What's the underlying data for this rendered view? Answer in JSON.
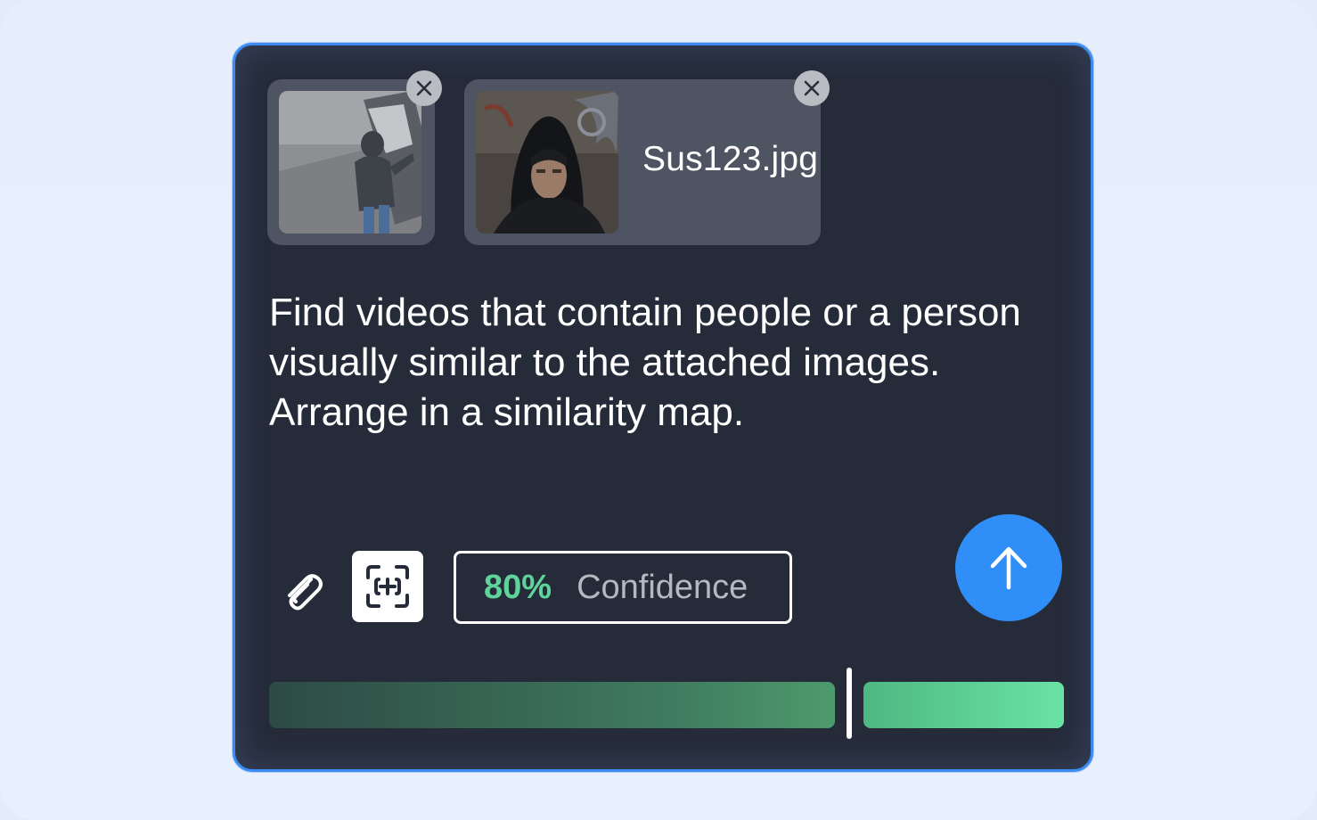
{
  "attachments": [
    {
      "icon": "cctv-person-thumbnail",
      "filename": "",
      "remove_icon": "close-icon"
    },
    {
      "icon": "hooded-person-thumbnail",
      "filename": "Sus123.jpg",
      "remove_icon": "close-icon"
    }
  ],
  "prompt": {
    "text": "Find videos that contain people or a person visually similar to the attached images. Arrange in a similarity map."
  },
  "toolbar": {
    "attach_icon": "paperclip-icon",
    "scan_icon": "scan-add-icon",
    "confidence": {
      "value": "80%",
      "label": "Confidence",
      "value_color": "#5fd49a"
    },
    "send_icon": "arrow-up-icon",
    "send_color": "#2f8ef7"
  },
  "threshold_slider": {
    "value": 0.73,
    "low_color": "#3f7a5e",
    "high_color": "#69e3a4"
  },
  "accent_color": "#3b8bf2"
}
